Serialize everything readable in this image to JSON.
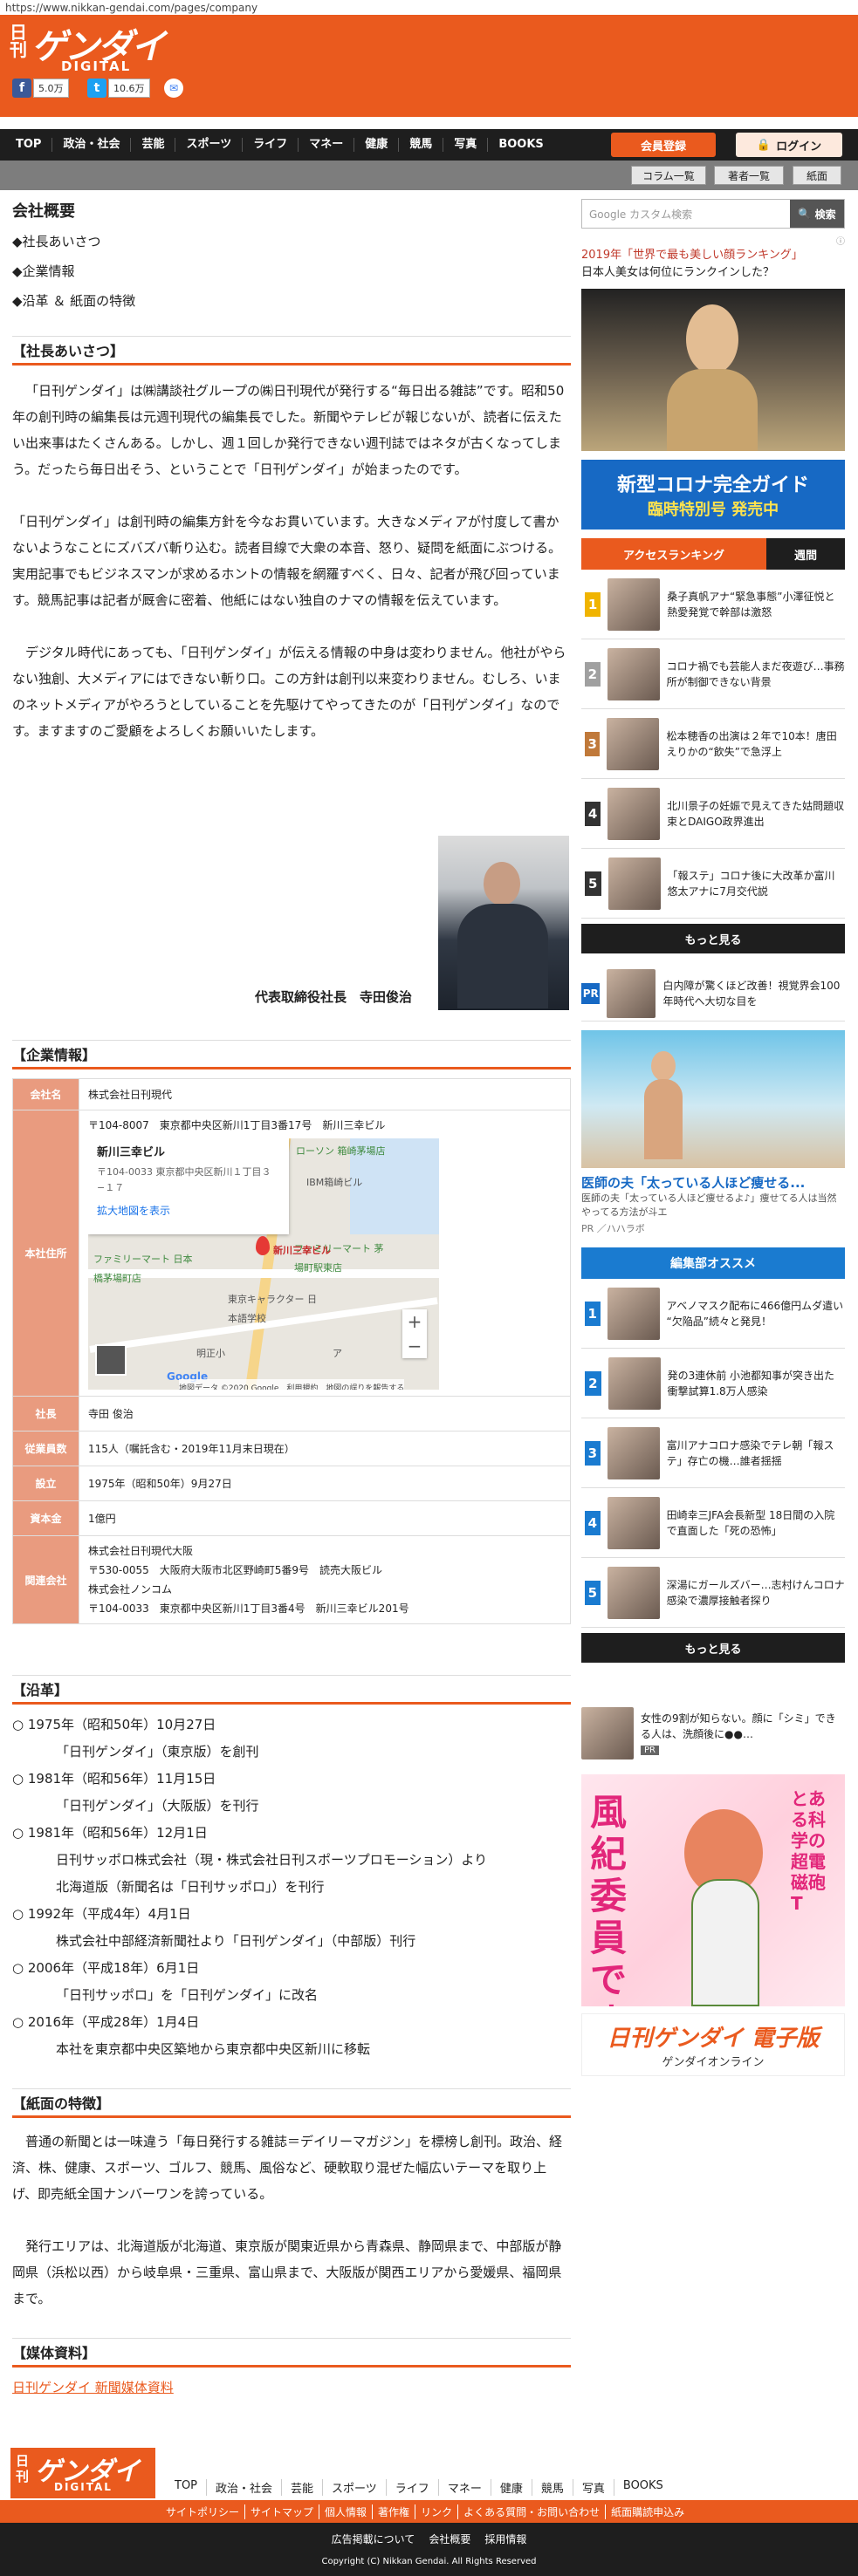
{
  "browser": {
    "url": "https://www.nikkan-gendai.com/pages/company"
  },
  "header": {
    "logo_small": "日刊",
    "logo_main": "ゲンダイ",
    "logo_sub": "DIGITAL",
    "facebook_count": "5.0万",
    "twitter_count": "10.6万",
    "register_label": "会員登録",
    "login_label": "ログイン"
  },
  "nav": {
    "items": [
      "TOP",
      "政治・社会",
      "芸能",
      "スポーツ",
      "ライフ",
      "マネー",
      "健康",
      "競馬",
      "写真",
      "BOOKS"
    ],
    "sub": [
      "コラム一覧",
      "著者一覧",
      "紙面"
    ]
  },
  "page": {
    "title": "会社概要",
    "toc": [
      "◆社長あいさつ",
      "◆企業情報",
      "◆沿革 ＆ 紙面の特徴"
    ]
  },
  "greeting": {
    "heading": "【社長あいさつ】",
    "p1": "「日刊ゲンダイ」は㈱講談社グループの㈱日刊現代が発行する“毎日出る雑誌”です。昭和50年の創刊時の編集長は元週刊現代の編集長でした。新聞やテレビが報じないが、読者に伝えたい出来事はたくさんある。しかし、週１回しか発行できない週刊誌ではネタが古くなってしまう。だったら毎日出そう、ということで「日刊ゲンダイ」が始まったのです。",
    "p2": "「日刊ゲンダイ」は創刊時の編集方針を今なお貫いています。大きなメディアが忖度して書かないようなことにズバズバ斬り込む。読者目線で大衆の本音、怒り、疑問を紙面にぶつける。実用記事でもビジネスマンが求めるホントの情報を網羅すべく、日々、記者が飛び回っています。競馬記事は記者が厩舎に密着、他紙にはない独自のナマの情報を伝えています。",
    "p3": "デジタル時代にあっても、「日刊ゲンダイ」が伝える情報の中身は変わりません。他社がやらない独創、大メディアにはできない斬り口。この方針は創刊以来変わりません。むしろ、いまのネットメディアがやろうとしていることを先駆けてやってきたのが「日刊ゲンダイ」なのです。ますますのご愛顧をよろしくお願いいたします。",
    "signature": "代表取締役社長　寺田俊治"
  },
  "company": {
    "heading": "【企業情報】",
    "rows": [
      {
        "k": "会社名",
        "v": "株式会社日刊現代"
      },
      {
        "k": "本社住所",
        "v": "〒104-8007　東京都中央区新川1丁目3番17号　新川三幸ビル"
      },
      {
        "k": "社長",
        "v": "寺田 俊治"
      },
      {
        "k": "従業員数",
        "v": "115人（嘱託含む・2019年11月末日現在）"
      },
      {
        "k": "設立",
        "v": "1975年（昭和50年）9月27日"
      },
      {
        "k": "資本金",
        "v": "1億円"
      },
      {
        "k": "関連会社",
        "v": "株式会社日刊現代大阪"
      }
    ],
    "related_lines": [
      "〒530-0055　大阪府大阪市北区野崎町5番9号　読売大阪ビル",
      "株式会社ノンコム",
      "〒104-0033　東京都中央区新川1丁目3番4号　新川三幸ビル201号"
    ],
    "map": {
      "place": "新川三幸ビル",
      "address": "〒104-0033 東京都中央区新川１丁目３−１７",
      "link": "拡大地図を表示",
      "pin_label": "新川三幸ビル",
      "labels": [
        "ローソン 箱崎茅場店",
        "IBM箱崎ビル",
        "ファミリーマート 茅場町駅東店",
        "ファミリーマート 日本橋茅場町店",
        "東京キャラクター 日本語学校",
        "明正小",
        "ア"
      ],
      "footer": "地図データ ©2020 Google　利用規約　地図の誤りを報告する",
      "google": "Google"
    }
  },
  "history": {
    "heading": "【沿革】",
    "items": [
      {
        "date": "1975年（昭和50年）10月27日",
        "lines": [
          "「日刊ゲンダイ」（東京版）を創刊"
        ]
      },
      {
        "date": "1981年（昭和56年）11月15日",
        "lines": [
          "「日刊ゲンダイ」（大阪版）を刊行"
        ]
      },
      {
        "date": "1981年（昭和56年）12月1日",
        "lines": [
          "日刊サッポロ株式会社（現・株式会社日刊スポーツプロモーション）より",
          "北海道版（新聞名は「日刊サッポロ」）を刊行"
        ]
      },
      {
        "date": "1992年（平成4年）4月1日",
        "lines": [
          "株式会社中部経済新聞社より「日刊ゲンダイ」（中部版）刊行"
        ]
      },
      {
        "date": "2006年（平成18年）6月1日",
        "lines": [
          "「日刊サッポロ」を「日刊ゲンダイ」に改名"
        ]
      },
      {
        "date": "2016年（平成28年）1月4日",
        "lines": [
          "本社を東京都中央区築地から東京都中央区新川に移転"
        ]
      }
    ]
  },
  "features": {
    "heading": "【紙面の特徴】",
    "p1": "普通の新聞とは一味違う「毎日発行する雑誌＝デイリーマガジン」を標榜し創刊。政治、経済、株、健康、スポーツ、ゴルフ、競馬、風俗など、硬軟取り混ぜた幅広いテーマを取り上げ、即売紙全国ナンバーワンを誇っている。",
    "p2": "発行エリアは、北海道版が北海道、東京版が関東近県から青森県、静岡県まで、中部版が静岡県（浜松以西）から岐阜県・三重県、富山県まで、大阪版が関西エリアから愛媛県、福岡県まで。"
  },
  "media": {
    "heading": "【媒体資料】",
    "link": "日刊ゲンダイ 新聞媒体資料"
  },
  "sidebar": {
    "search_placeholder": "Google カスタム検索",
    "search_button": "検索",
    "ad1_title": "2019年「世界で最も美しい顔ランキング」",
    "ad1_sub": "日本人美女は何位にランクインした？",
    "corona_banner_1": "新型コロナ完全ガイド",
    "corona_banner_2": "臨時特別号 発売中",
    "ranking_tab_1": "アクセスランキング",
    "ranking_tab_2": "週間",
    "ranking": [
      "桑子真帆アナ“緊急事態”小澤征悦と熱愛発覚で幹部は激怒",
      "コロナ禍でも芸能人まだ夜遊び…事務所が制御できない背景",
      "松本穂香の出演は２年で10本！唐田えりかの“飲失”で急浮上",
      "北川景子の妊娠で見えてきた姑問題収束とDAIGO政界進出",
      "「報ステ」コロナ後に大改革か富川悠太アナに7月交代説"
    ],
    "more": "もっと見る",
    "pr_text": "白内障が驚くほど改善！視覚界会100年時代へ大切な目を",
    "pr_badge": "PR",
    "ad2_title": "医師の夫「太っている人ほど痩せる...",
    "ad2_sub": "医師の夫「太っている人ほど痩せるよ♪」痩せてる人は当然やってる方法が斗エ",
    "ad2_src": "PR ／ハハラボ",
    "recommend_title": "編集部オススメ",
    "recommend": [
      "アベノマスク配布に466億円ムダ遣い “欠陥品”続々と発見！",
      "発の3連休前 小池都知事が突き出た衝撃試算1.8万人感染",
      "富川アナコロナ感染でテレ朝「報ステ」存亡の機…誰者揺揺",
      "田崎幸三JFA会長新型 18日間の入院で直面した「死の恐怖」",
      "深湯にガールズバー…志村けんコロナ感染で濃厚接触者探り"
    ],
    "ad3_text": "女性の9割が知らない。顔に「シミ」できる人は、洗顔後に●●…",
    "ad3_badge": "PR",
    "anime_text": "風紀委員ですの!",
    "anime_side": "とある科学の超電磁砲T",
    "digital_banner_1": "日刊ゲンダイ 電子版",
    "digital_banner_2": "ゲンダイオンライン"
  },
  "footer": {
    "nav": [
      "TOP",
      "政治・社会",
      "芸能",
      "スポーツ",
      "ライフ",
      "マネー",
      "健康",
      "競馬",
      "写真",
      "BOOKS"
    ],
    "links": [
      "サイトポリシー",
      "サイトマップ",
      "個人情報",
      "著作権",
      "リンク",
      "よくある質問・お問い合わせ",
      "紙面購読申込み"
    ],
    "bottom_links": [
      "広告掲載について",
      "会社概要",
      "採用情報"
    ],
    "copyright": "Copyright (C) Nikkan Gendai. All Rights Reserved"
  },
  "colors": {
    "brand": "#ea5a1e",
    "nav_bg": "#1e1e1e",
    "rank_blue": "#1a7bd0"
  }
}
